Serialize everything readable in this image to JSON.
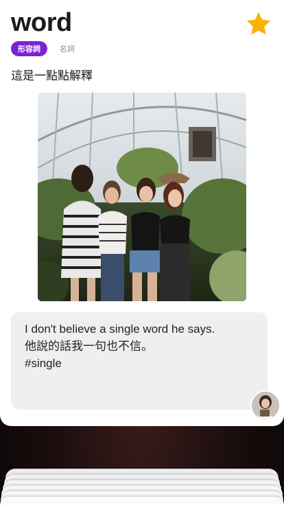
{
  "card": {
    "word": "word",
    "starred": true,
    "tags": {
      "active": "形容詞",
      "inactive": "名詞"
    },
    "meaning": "這是一點點解釋",
    "example": {
      "english": "I don't believe a single word he says.",
      "chinese": "他說的話我一句也不信。",
      "hashtag": "#single"
    }
  },
  "colors": {
    "accent": "#7b22d6",
    "star": "#f8b400",
    "example_bg": "#efefef"
  },
  "icons": {
    "favorite": "star-icon",
    "author": "avatar"
  }
}
